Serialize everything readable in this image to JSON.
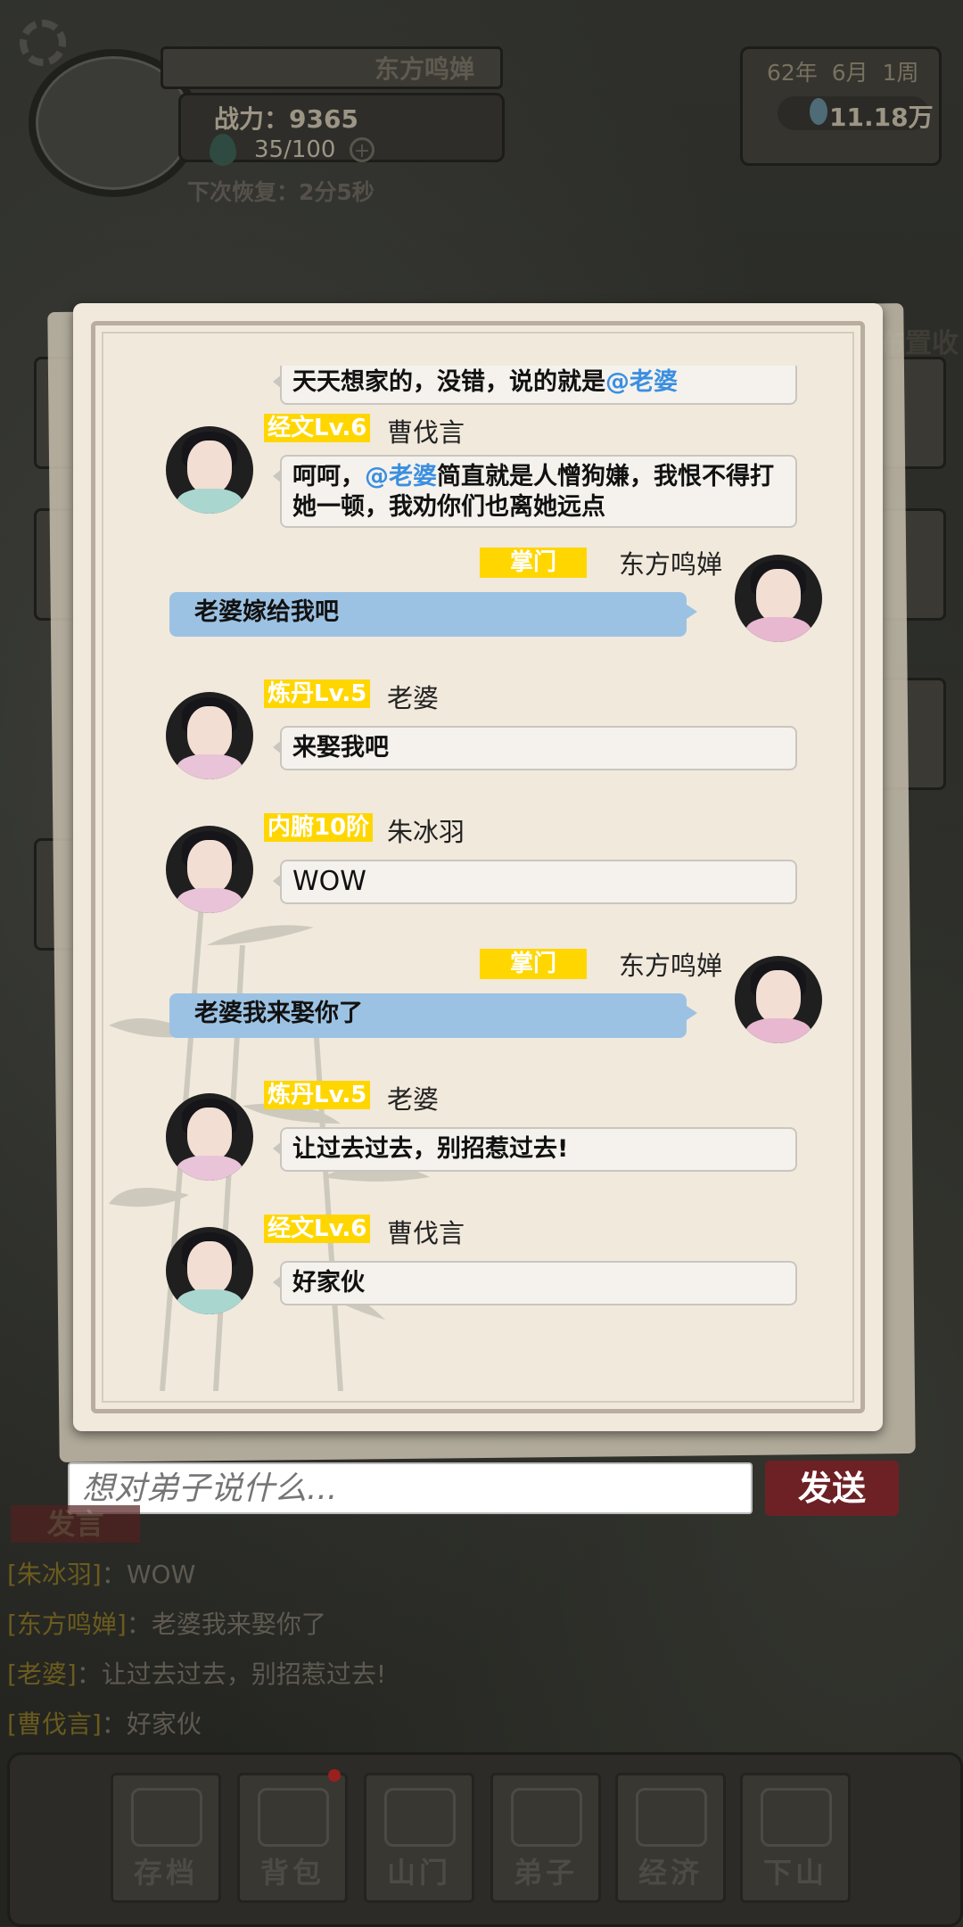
{
  "status": {
    "player_name": "东方鸣婵",
    "power": "战力：9365",
    "energy": "35/100",
    "recover": "下次恢复：2分5秒",
    "date": "62年 6月 1周",
    "money": "11.18万",
    "side_banner": "布置收"
  },
  "colors": {
    "tag_yellow": "#ffd600",
    "self_bubble": "#9cc2e3",
    "mention_blue": "#3b8fe0",
    "send_button": "#6d2125",
    "panel_paper": "#f1e9dc"
  },
  "chat": {
    "messages": [
      {
        "side": "left",
        "tag": "",
        "sender": "",
        "text_pre": "天天想家的，没错，说的就是",
        "mention": "@老婆",
        "text_post": ""
      },
      {
        "side": "left",
        "tag": "经文Lv.6",
        "sender": "曹伐言",
        "text_pre": "呵呵，",
        "mention": "@老婆",
        "text_post": "简直就是人憎狗嫌，我恨不得打她一顿，我劝你们也离她远点"
      },
      {
        "side": "right",
        "tag": "掌门",
        "sender": "东方鸣婵",
        "text": "老婆嫁给我吧"
      },
      {
        "side": "left",
        "tag": "炼丹Lv.5",
        "sender": "老婆",
        "text": "来娶我吧"
      },
      {
        "side": "left",
        "tag": "内腑10阶",
        "sender": "朱冰羽",
        "text": "WOW"
      },
      {
        "side": "right",
        "tag": "掌门",
        "sender": "东方鸣婵",
        "text": "老婆我来娶你了"
      },
      {
        "side": "left",
        "tag": "炼丹Lv.5",
        "sender": "老婆",
        "text": "让过去过去，别招惹过去!"
      },
      {
        "side": "left",
        "tag": "经文Lv.6",
        "sender": "曹伐言",
        "text": "好家伙"
      }
    ]
  },
  "input": {
    "placeholder": "想对弟子说什么...",
    "send_label": "发送"
  },
  "log": {
    "tab_label": "发言",
    "lines": [
      {
        "name": "[朱冰羽]",
        "text": "：WOW"
      },
      {
        "name": "[东方鸣婵]",
        "text": "：老婆我来娶你了"
      },
      {
        "name": "[老婆]",
        "text": "：让过去过去，别招惹过去!"
      },
      {
        "name": "[曹伐言]",
        "text": "：好家伙"
      }
    ]
  },
  "nav": [
    {
      "label": "存档",
      "icon": "scroll-icon"
    },
    {
      "label": "背包",
      "icon": "bag-icon"
    },
    {
      "label": "山门",
      "icon": "gate-icon"
    },
    {
      "label": "弟子",
      "icon": "disciple-icon"
    },
    {
      "label": "经济",
      "icon": "coins-icon"
    },
    {
      "label": "下山",
      "icon": "mountain-icon"
    }
  ]
}
